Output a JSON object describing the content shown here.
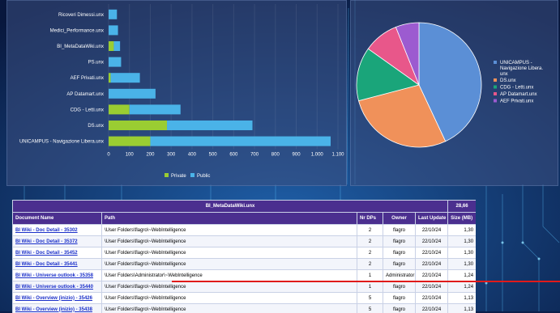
{
  "colors": {
    "private": "#9acd32",
    "public": "#4ab3e8",
    "table_header": "#4b2f8f",
    "link": "#1a2fc9",
    "highlight_line": "#e01a1a"
  },
  "chart_data": [
    {
      "type": "bar",
      "orientation": "horizontal",
      "stacked": true,
      "categories": [
        "UNICAMPUS - Navigazione Libera.unx",
        "DS.unx",
        "CDG - Letti.unx",
        "AP Datamart.unx",
        "AEF Privati.unx",
        "PS.unx",
        "BI_MetaDataWiki.unx",
        "Medici_Performance.unx",
        "Ricoveri Dimessi.unx"
      ],
      "series": [
        {
          "name": "Private",
          "values": [
            200,
            280,
            100,
            0,
            10,
            0,
            25,
            0,
            0
          ]
        },
        {
          "name": "Public",
          "values": [
            865,
            410,
            245,
            225,
            140,
            60,
            30,
            45,
            40
          ]
        }
      ],
      "xticks": [
        "0",
        "100",
        "200",
        "300",
        "400",
        "500",
        "600",
        "700",
        "800",
        "900",
        "1.000",
        "1.100"
      ],
      "xlim": [
        0,
        1100
      ],
      "legend": "bottom"
    },
    {
      "type": "pie",
      "labels": [
        "UNICAMPUS - Navigazione Libera.unx",
        "DS.unx",
        "CDG - Letti.unx",
        "AP Datamart.unx",
        "AEF Privati.unx"
      ],
      "values": [
        1065,
        690,
        345,
        225,
        150
      ],
      "colors": [
        "#5b8fd6",
        "#f0915a",
        "#1aa57a",
        "#e8578a",
        "#9c5bd0"
      ],
      "legend": "right"
    }
  ],
  "table": {
    "title": "BI_MetaDataWiki.unx",
    "total_size": "28,66",
    "columns": [
      "Document Name",
      "Path",
      "Nr DPs",
      "Owner",
      "Last Update",
      "Size (MB)"
    ],
    "rows": [
      [
        "BI Wiki - Doc Detail - 35302",
        "\\User Folders\\flagro\\~WebIntelligence",
        "2",
        "flagro",
        "22/10/24",
        "1,30"
      ],
      [
        "BI Wiki - Doc Detail - 35372",
        "\\User Folders\\flagro\\~WebIntelligence",
        "2",
        "flagro",
        "22/10/24",
        "1,30"
      ],
      [
        "BI Wiki - Doc Detail - 35452",
        "\\User Folders\\flagro\\~WebIntelligence",
        "2",
        "flagro",
        "22/10/24",
        "1,30"
      ],
      [
        "BI Wiki - Doc Detail - 35441",
        "\\User Folders\\flagro\\~WebIntelligence",
        "2",
        "flagro",
        "22/10/24",
        "1,30"
      ],
      [
        "BI Wiki - Universe outlook - 35358",
        "\\User Folders\\Administrator\\~WebIntelligence",
        "1",
        "Administrator",
        "22/10/24",
        "1,24"
      ],
      [
        "BI Wiki - Universe outlook - 35440",
        "\\User Folders\\flagro\\~WebIntelligence",
        "1",
        "flagro",
        "22/10/24",
        "1,24"
      ],
      [
        "BI Wiki - Overview (inizio) - 35426",
        "\\User Folders\\flagro\\~WebIntelligence",
        "5",
        "flagro",
        "22/10/24",
        "1,13"
      ],
      [
        "BI Wiki - Overview (inizio) - 35438",
        "\\User Folders\\flagro\\~WebIntelligence",
        "5",
        "flagro",
        "22/10/24",
        "1,13"
      ]
    ]
  }
}
